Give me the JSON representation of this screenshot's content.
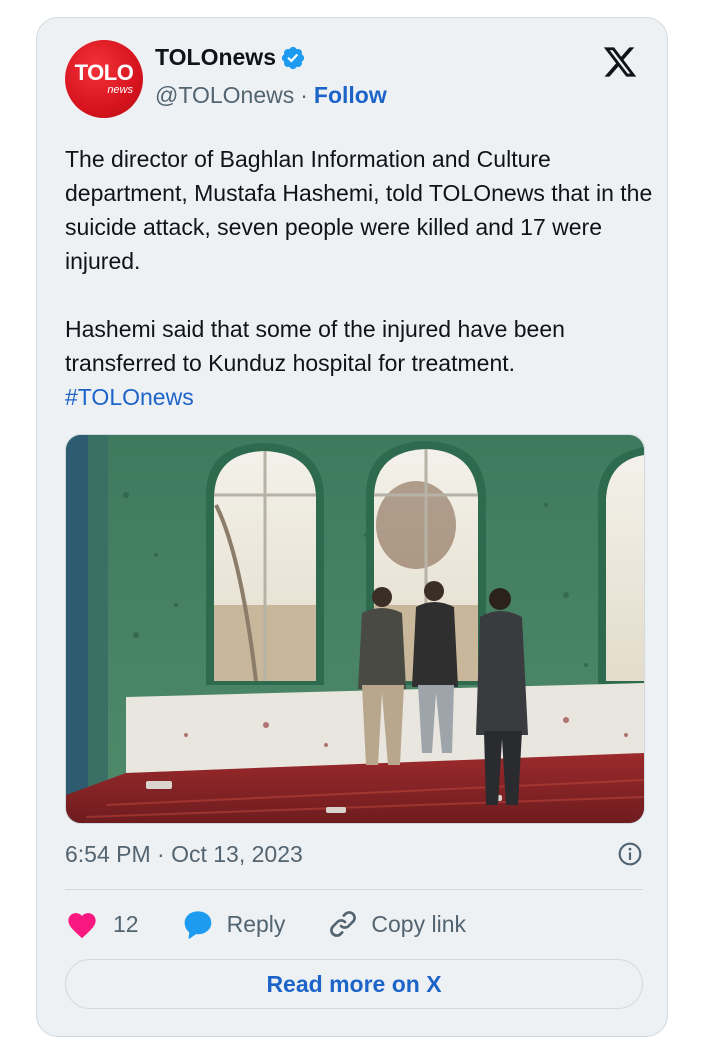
{
  "author": {
    "display_name": "TOLOnews",
    "handle": "@TOLOnews",
    "separator": "·",
    "follow_label": "Follow",
    "avatar_logo_main": "TOLO",
    "avatar_logo_sub": "news",
    "verified_icon": "verified-badge-icon"
  },
  "header": {
    "platform_icon": "x-logo-icon"
  },
  "tweet": {
    "paragraph_1": "The director of Baghlan Information and Culture department, Mustafa Hashemi, told TOLOnews that in the suicide attack, seven people were killed and 17 were injured.",
    "paragraph_2": "Hashemi said that some of the injured have been transferred to Kunduz hospital for treatment.",
    "hashtag": "#TOLOnews"
  },
  "media": {
    "icon": "photo-mosque-interior"
  },
  "meta": {
    "timestamp": "6:54 PM · Oct 13, 2023",
    "info_icon": "info-icon"
  },
  "actions": {
    "like_count": "12",
    "reply_label": "Reply",
    "copy_link_label": "Copy link"
  },
  "footer": {
    "read_more_label": "Read more on X"
  },
  "colors": {
    "card_background": "#eef1f4",
    "link_blue": "#1d64c8",
    "like_pink": "#f91880",
    "reply_blue": "#1d9bf0",
    "brand_red": "#d7141e"
  }
}
